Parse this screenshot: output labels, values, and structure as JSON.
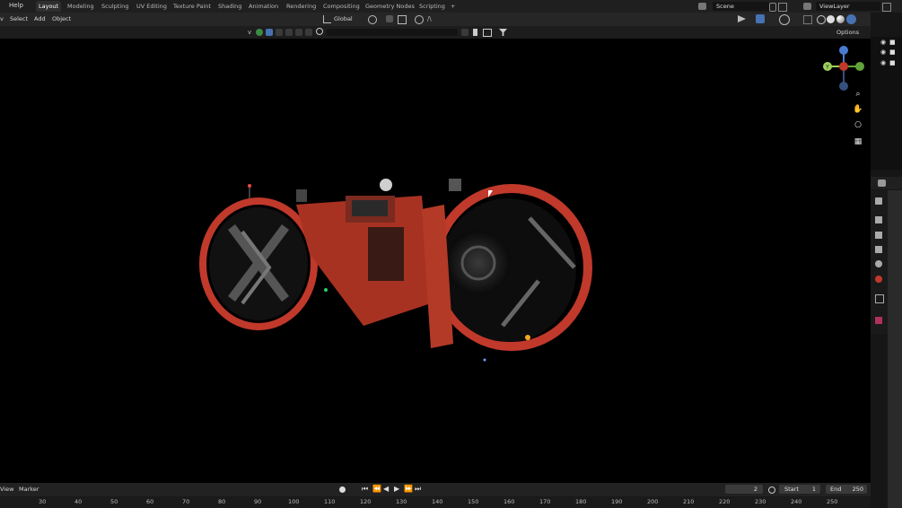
{
  "top_menu": {
    "help": "Help"
  },
  "workspace_tabs": [
    "Layout",
    "Modeling",
    "Sculpting",
    "UV Editing",
    "Texture Paint",
    "Shading",
    "Animation",
    "Rendering",
    "Compositing",
    "Geometry Nodes",
    "Scripting",
    "+"
  ],
  "scene": {
    "name": "Scene",
    "view_layer": "ViewLayer"
  },
  "header": {
    "menus": [
      "Select",
      "Add",
      "Object"
    ],
    "orientation": "Global",
    "options": "Options"
  },
  "timeline": {
    "menus": [
      "View",
      "Marker"
    ],
    "current_frame": "2",
    "start_label": "Start",
    "start_value": "1",
    "end_label": "End",
    "end_value": "250",
    "ruler_ticks": [
      "30",
      "40",
      "50",
      "60",
      "70",
      "80",
      "90",
      "100",
      "110",
      "120",
      "130",
      "140",
      "150",
      "160",
      "170",
      "180",
      "190",
      "200",
      "210",
      "220",
      "230",
      "240",
      "250"
    ]
  },
  "gizmo": {
    "z": "Z",
    "y": "Y",
    "x": "X"
  },
  "colors": {
    "accent": "#4772b3",
    "active_tab": "#2f2f2f",
    "ship_orange": "#d6452a"
  }
}
